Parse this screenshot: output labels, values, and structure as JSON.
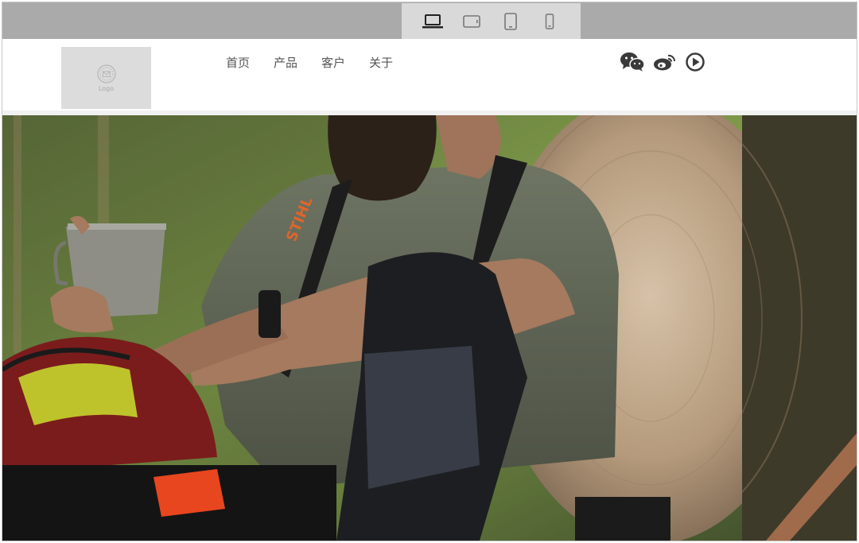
{
  "device_toolbar": {
    "devices": [
      {
        "icon": "laptop-icon",
        "active": true
      },
      {
        "icon": "tablet-landscape-icon",
        "active": false
      },
      {
        "icon": "tablet-portrait-icon",
        "active": false
      },
      {
        "icon": "phone-icon",
        "active": false
      }
    ]
  },
  "header": {
    "logo_text": "Logo",
    "nav": [
      {
        "label": "首页"
      },
      {
        "label": "产品"
      },
      {
        "label": "客户"
      },
      {
        "label": "关于"
      }
    ],
    "social": [
      {
        "icon": "wechat-icon"
      },
      {
        "icon": "weibo-icon"
      },
      {
        "icon": "video-play-icon"
      }
    ]
  },
  "hero": {
    "image_subject": "man-resting-against-log-with-cup-photo",
    "strap_text": "STIHL"
  },
  "colors": {
    "toolbar_bg": "#aaaaaa",
    "device_group_bg": "#d9d9d9",
    "icon_dark": "#3a3a3a",
    "nav_text": "#555555"
  }
}
